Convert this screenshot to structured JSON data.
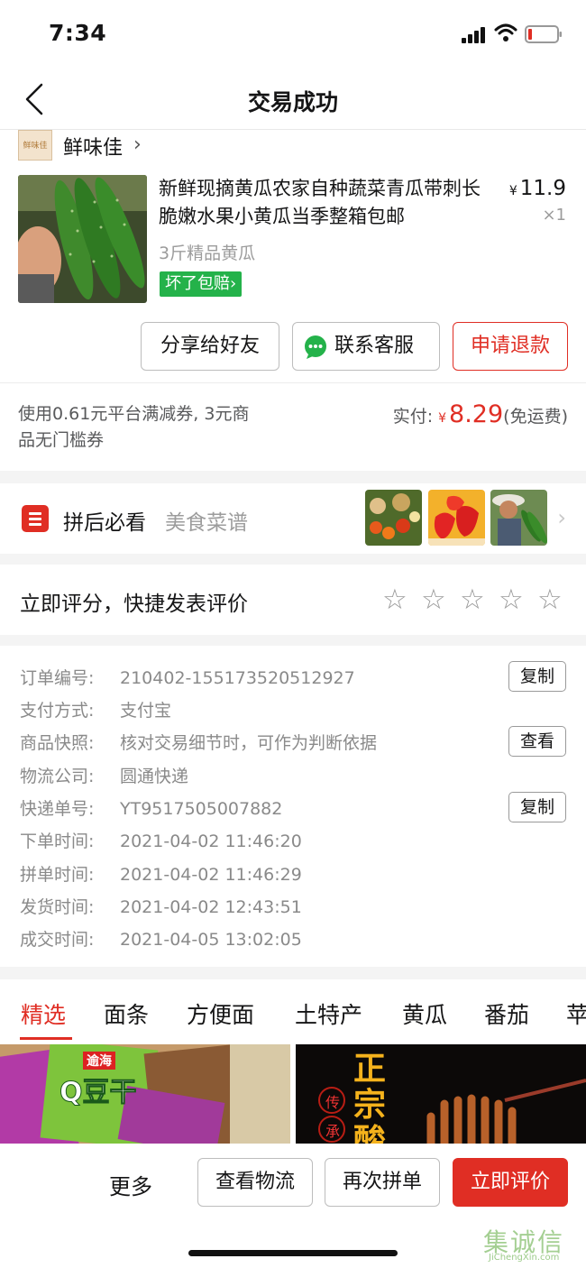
{
  "status_bar": {
    "time": "7:34"
  },
  "nav": {
    "title": "交易成功"
  },
  "store": {
    "name": "鲜味佳",
    "logo_text": "鲜味佳"
  },
  "product": {
    "title": "新鲜现摘黄瓜农家自种蔬菜青瓜带刺长脆嫩水果小黄瓜当季整箱包邮",
    "price_symbol": "¥",
    "price": "11.9",
    "quantity": "×1",
    "spec": "3斤精品黄瓜",
    "guarantee": "坏了包赔"
  },
  "actions": {
    "share": "分享给好友",
    "contact": "联系客服",
    "refund": "申请退款"
  },
  "payment": {
    "coupon_note": "使用0.61元平台满减券, 3元商品无门槛券",
    "paid_label": "实付:",
    "currency": "¥",
    "paid_amount": "8.29",
    "shipping_note": "(免运费)"
  },
  "must_see": {
    "title": "拼后必看",
    "subtitle": "美食菜谱"
  },
  "rating": {
    "label": "立即评分，快捷发表评价",
    "max_stars": 5,
    "filled": 0
  },
  "order_info": {
    "rows": [
      {
        "label": "订单编号:",
        "value": "210402-155173520512927",
        "button": "复制"
      },
      {
        "label": "支付方式:",
        "value": "支付宝"
      },
      {
        "label": "商品快照:",
        "value": "核对交易细节时，可作为判断依据",
        "button": "查看"
      },
      {
        "label": "物流公司:",
        "value": "圆通快递"
      },
      {
        "label": "快递单号:",
        "value": "YT9517505007882",
        "button": "复制"
      },
      {
        "label": "下单时间:",
        "value": "2021-04-02 11:46:20"
      },
      {
        "label": "拼单时间:",
        "value": "2021-04-02 11:46:29"
      },
      {
        "label": "发货时间:",
        "value": "2021-04-02 12:43:51"
      },
      {
        "label": "成交时间:",
        "value": "2021-04-05 13:02:05"
      }
    ]
  },
  "tabs": [
    "精选",
    "面条",
    "方便面",
    "土特产",
    "黄瓜",
    "番茄",
    "苹"
  ],
  "feed": {
    "item1_text": "Q豆干",
    "item1_brand": "逾海",
    "item2_text": "正宗酸",
    "item2_stamp": "传承"
  },
  "bottom_bar": {
    "more": "更多",
    "logistics": "查看物流",
    "reorder": "再次拼单",
    "review": "立即评价"
  },
  "watermark": {
    "main": "集诚信",
    "url": "JiChengXin.com"
  },
  "colors": {
    "accent": "#e02e24",
    "green": "#24b24a",
    "muted": "#9c9c9c"
  }
}
